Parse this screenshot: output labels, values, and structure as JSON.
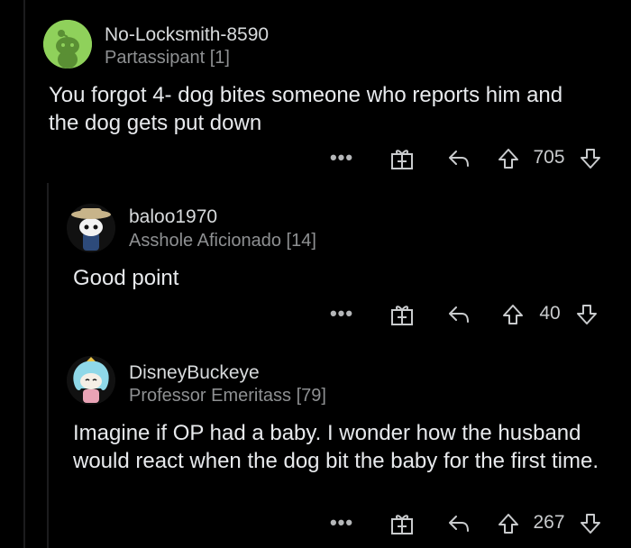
{
  "comments": [
    {
      "username": "No-Locksmith-8590",
      "flair": "Partassipant [1]",
      "body": "You forgot 4- dog bites someone who reports him and the dog gets put down",
      "more": "•••",
      "votes": "705",
      "avatar_color": "#8fd15b"
    },
    {
      "username": "baloo1970",
      "flair": "Asshole Aficionado [14]",
      "body": "Good point",
      "more": "•••",
      "votes": "40"
    },
    {
      "username": "DisneyBuckeye",
      "flair": "Professor Emeritass [79]",
      "body": "Imagine if OP had a baby.  I wonder how the husband would react when the dog bit the baby for the first time.",
      "more": "•••",
      "votes": "267"
    }
  ],
  "icons": {
    "award": "gift-box-icon",
    "reply": "reply-arrow-icon",
    "upvote": "upvote-arrow-icon",
    "downvote": "downvote-arrow-icon"
  },
  "colors": {
    "background": "#000000",
    "text": "#e8eaed",
    "muted": "#8e9092",
    "icon": "#c9cbcd"
  }
}
